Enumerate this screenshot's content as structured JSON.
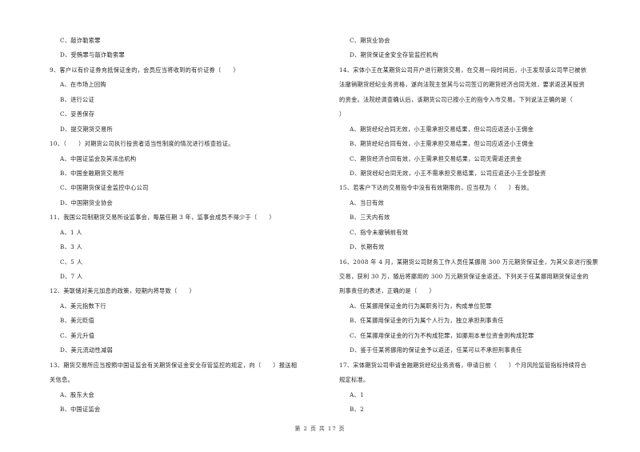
{
  "left_column": [
    {
      "type": "opt",
      "text": "C、敲诈勒索罪"
    },
    {
      "type": "opt",
      "text": "D、受贿罪与敲诈勒索罪"
    },
    {
      "type": "q",
      "text": "9、客户以有价证券充抵保证金的，会员应当将收到的有价证券（　　）"
    },
    {
      "type": "opt",
      "text": "A、在市场上回购"
    },
    {
      "type": "opt",
      "text": "B、进行公证"
    },
    {
      "type": "opt",
      "text": "C、妥善保存"
    },
    {
      "type": "opt",
      "text": "D、提交期货交易所"
    },
    {
      "type": "q",
      "text": "10、（　　）对期货公司执行投资者适当性制度的情况进行核查验证。"
    },
    {
      "type": "opt",
      "text": "A、中国证监会及其派出机构"
    },
    {
      "type": "opt",
      "text": "B、中国金融期货交易所"
    },
    {
      "type": "opt",
      "text": "C、中国期货保证金监控中心公司"
    },
    {
      "type": "opt",
      "text": "D、中国期货业协会"
    },
    {
      "type": "q",
      "text": "11、我国公司制期货交易所设监事会，每届任期 3 年，监事会成员不得少于（　　）"
    },
    {
      "type": "opt",
      "text": "A、1 人"
    },
    {
      "type": "opt",
      "text": "B、3 人"
    },
    {
      "type": "opt",
      "text": "C、5 人"
    },
    {
      "type": "opt",
      "text": "D、7 人"
    },
    {
      "type": "q",
      "text": "12、美联储对美元加息的政策，短期内将导致（　　）"
    },
    {
      "type": "opt",
      "text": "A、美元指数下行"
    },
    {
      "type": "opt",
      "text": "B、美元贬值"
    },
    {
      "type": "opt",
      "text": "C、美元升值"
    },
    {
      "type": "opt",
      "text": "D、美元流动性减弱"
    },
    {
      "type": "q",
      "text": "13、期货交易所应当按照中国证监会有关期货保证金安全存管监控的规定，向（　　）报送相"
    },
    {
      "type": "q",
      "text": "关信息。"
    },
    {
      "type": "opt",
      "text": "A、股东大会"
    },
    {
      "type": "opt",
      "text": "B、中国证监会"
    }
  ],
  "right_column": [
    {
      "type": "opt",
      "text": "C、期货业协会"
    },
    {
      "type": "opt",
      "text": "D、期货保证金安全存管监控机构"
    },
    {
      "type": "q",
      "text": "14、宋体小王在某期货公司开户进行期货交易，在交易一段时间后，小王发现该公司早已被依"
    },
    {
      "type": "q",
      "text": "法撤销期货经纪业务资格，遂向法院主张其与公司签订的期货经济合同无效，要求返还其投资"
    },
    {
      "type": "q",
      "text": "的资金。法院经调查确认后，该期货公司已按小王的指令入市交易。下列说法正确的是（"
    },
    {
      "type": "q",
      "text": "）"
    },
    {
      "type": "opt",
      "text": "A、期货经纪合同无效，小王需承担交易结果，但公司应返还小王佣金"
    },
    {
      "type": "opt",
      "text": "B、期货经纪合同有效，小王需承担交易结果，但公司应返还小王佣金"
    },
    {
      "type": "opt",
      "text": "C、期货经济合同有效，小王需承担交易结果，公司无需返还资金"
    },
    {
      "type": "opt",
      "text": "D、期货经纪合同无效，小王不需承担交易结果，公司应返还小王全部投资"
    },
    {
      "type": "q",
      "text": "15、若客户下达的交易指令中没有有效期限的，应当视为（　　）有效。"
    },
    {
      "type": "opt",
      "text": "A、当日有效"
    },
    {
      "type": "opt",
      "text": "B、三天内有效"
    },
    {
      "type": "opt",
      "text": "C、指令未撤销前有效"
    },
    {
      "type": "opt",
      "text": "D、长期有效"
    },
    {
      "type": "q",
      "text": "16、2008 年 4 月，某期货公司财务工作人员任某挪用 300 万元期货保证金，为其父亲进行股票"
    },
    {
      "type": "q",
      "text": "交易，获利 30 万，随后将挪用的 300 万元期货保证金返还。下列关于任某挪用期货保证金的"
    },
    {
      "type": "q",
      "text": "刑事责任的表述，正确的是（　　）"
    },
    {
      "type": "opt",
      "text": "A、任某挪用保证金的行为属职务行为，构成单位犯罪"
    },
    {
      "type": "opt",
      "text": "B、任某挪用保证金的行为属个人行为，独立承担刑事责任"
    },
    {
      "type": "opt",
      "text": "C、任某挪用保证金的行为不构成犯罪，如挪用本单位资金则构成犯罪"
    },
    {
      "type": "opt",
      "text": "D、鉴于任某将挪用的保证金予以返还，任某可以不承担刑事责任"
    },
    {
      "type": "q",
      "text": "17、宋体期货公司申请金融期货经纪业务资格，申请日前（　　）个月风险监管指标持续符合"
    },
    {
      "type": "q",
      "text": "规定标准。"
    },
    {
      "type": "opt",
      "text": "A、1"
    },
    {
      "type": "opt",
      "text": "B、2"
    }
  ],
  "footer": {
    "page_label": "第 2 页 共 17 页"
  }
}
